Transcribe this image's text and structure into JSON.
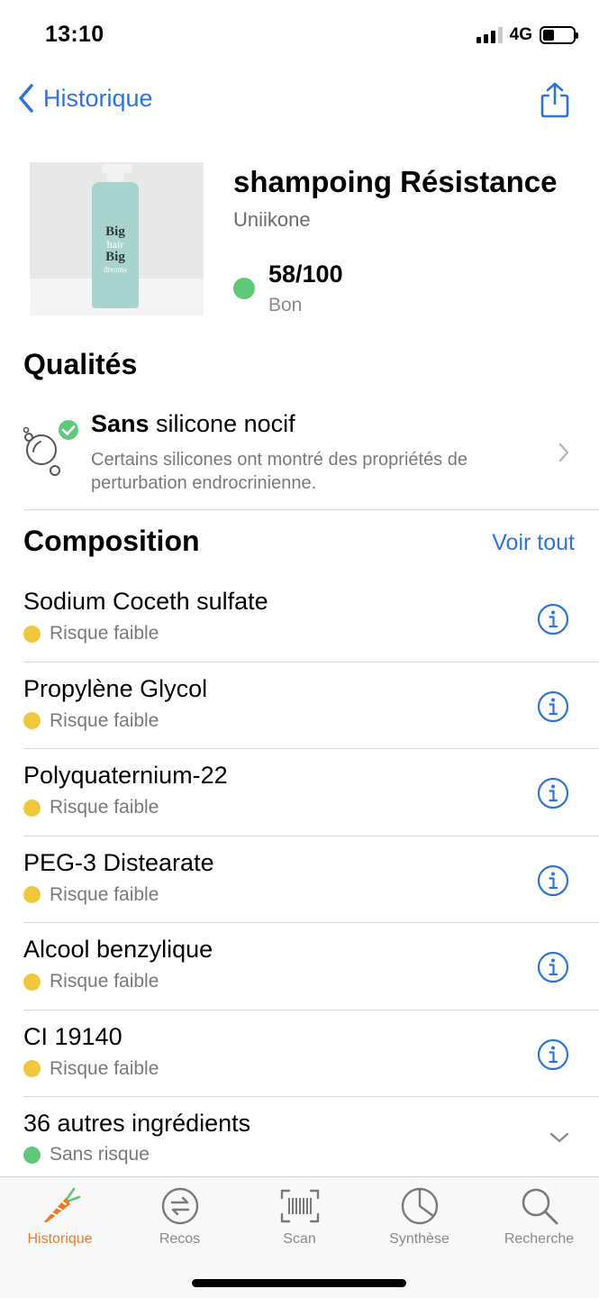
{
  "status": {
    "time": "13:10",
    "network": "4G"
  },
  "nav": {
    "back_label": "Historique",
    "share_icon": "share-icon"
  },
  "product": {
    "name": "shampoing Résistance",
    "brand": "Uniikone",
    "score": "58/100",
    "score_label": "Bon",
    "score_color": "#5ec97b",
    "image_label": [
      "Big",
      "hair",
      "Big",
      "dreams"
    ]
  },
  "qualites": {
    "title": "Qualités",
    "items": [
      {
        "title_bold": "Sans",
        "title_rest": " silicone nocif",
        "description": "Certains silicones ont montré des propriétés de perturbation endrocrinienne.",
        "icon": "bubbles-check-icon"
      }
    ]
  },
  "composition": {
    "title": "Composition",
    "see_all": "Voir tout",
    "ingredients": [
      {
        "name": "Sodium Coceth sulfate",
        "risk": "Risque faible"
      },
      {
        "name": "Propylène Glycol",
        "risk": "Risque faible"
      },
      {
        "name": "Polyquaternium-22",
        "risk": "Risque faible"
      },
      {
        "name": "PEG-3 Distearate",
        "risk": "Risque faible"
      },
      {
        "name": "Alcool benzylique",
        "risk": "Risque faible"
      },
      {
        "name": "CI 19140",
        "risk": "Risque faible"
      }
    ],
    "more": {
      "name": "36 autres ingrédients",
      "risk": "Sans risque"
    },
    "risk_colors": {
      "low": "#f0c83e",
      "none": "#5ec97b"
    }
  },
  "tabbar": {
    "tabs": [
      {
        "label": "Historique",
        "icon": "carrot-icon",
        "active": true
      },
      {
        "label": "Recos",
        "icon": "recos-icon",
        "active": false
      },
      {
        "label": "Scan",
        "icon": "barcode-icon",
        "active": false
      },
      {
        "label": "Synthèse",
        "icon": "pie-chart-icon",
        "active": false
      },
      {
        "label": "Recherche",
        "icon": "search-icon",
        "active": false
      }
    ],
    "active_color": "#ef7b2a"
  }
}
